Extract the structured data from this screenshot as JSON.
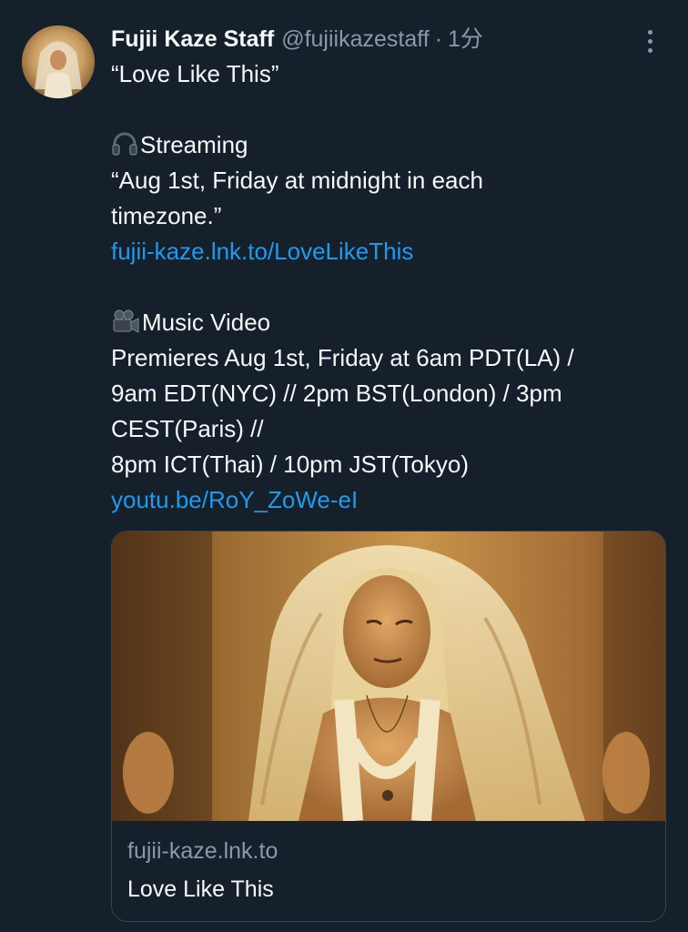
{
  "author": {
    "display_name": "Fujii Kaze Staff",
    "handle": "@fujiikazestaff",
    "separator": "·",
    "time": "1分"
  },
  "tweet": {
    "line_title": "“Love Like This”",
    "streaming_heading": "Streaming",
    "streaming_line1": "“Aug 1st, Friday at midnight in each",
    "streaming_line2": "timezone.”",
    "streaming_link": "fujii-kaze.lnk.to/LoveLikeThis",
    "video_heading": "Music Video",
    "video_line1": "Premieres Aug 1st, Friday at 6am PDT(LA) /",
    "video_line2": "9am EDT(NYC) // 2pm BST(London) / 3pm",
    "video_line3": "CEST(Paris) //",
    "video_line4": "8pm ICT(Thai) / 10pm JST(Tokyo)",
    "video_link": "youtu.be/RoY_ZoWe-eI"
  },
  "icons": {
    "streaming": "headphone-icon",
    "video": "video-camera-icon",
    "more": "more-options-icon"
  },
  "card": {
    "domain": "fujii-kaze.lnk.to",
    "title": "Love Like This"
  },
  "colors": {
    "background": "#15202b",
    "text": "#f7f9f9",
    "secondary": "#8b98a5",
    "link": "#1d9bf0",
    "border": "#38444d"
  }
}
